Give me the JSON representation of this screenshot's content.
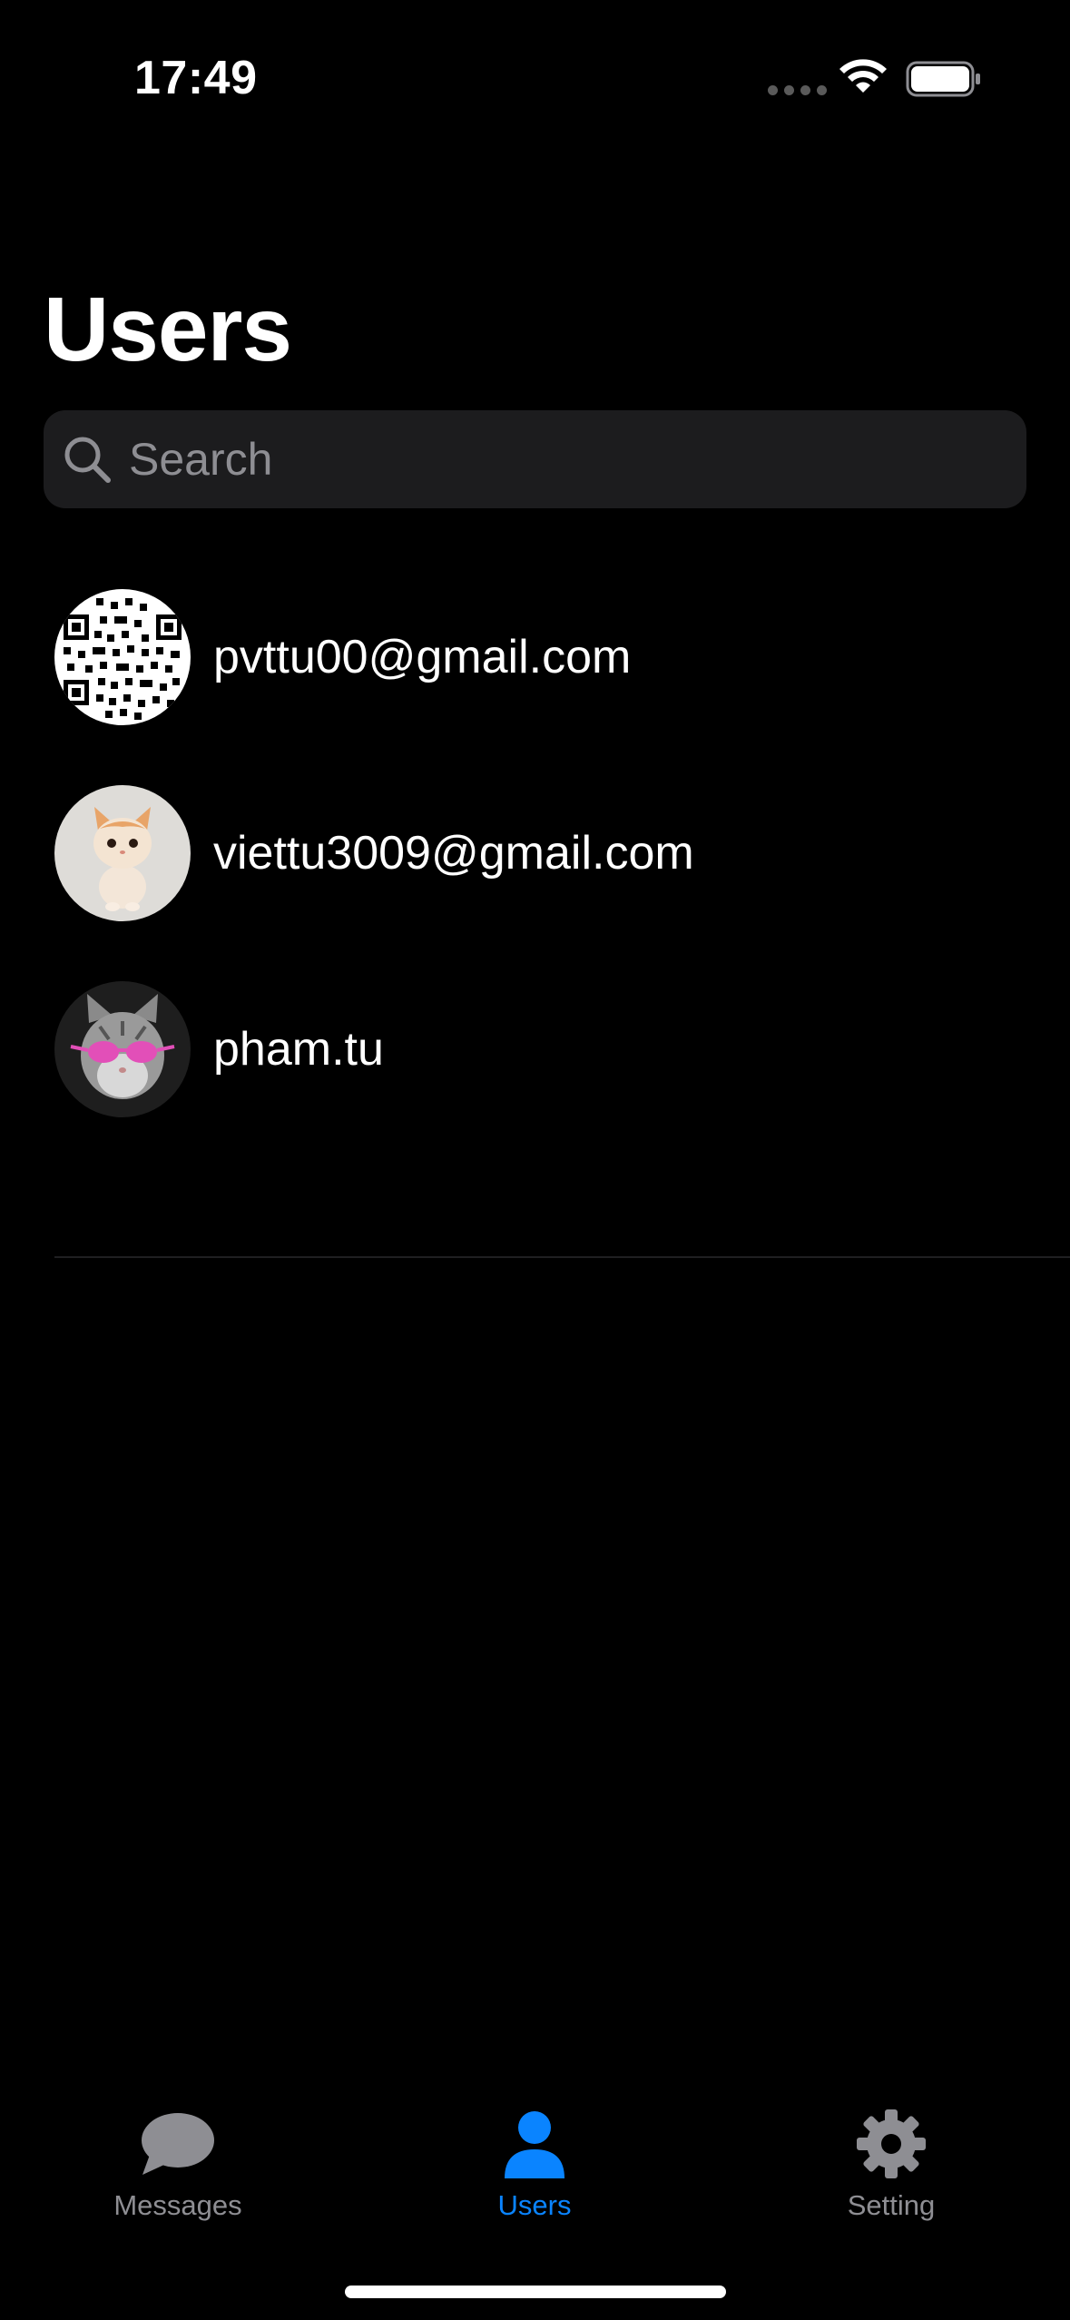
{
  "status_bar": {
    "time": "17:49"
  },
  "header": {
    "title": "Users"
  },
  "search": {
    "placeholder": "Search",
    "value": ""
  },
  "users": [
    {
      "name": "pvttu00@gmail.com",
      "avatar": "qr-code-avatar"
    },
    {
      "name": "viettu3009@gmail.com",
      "avatar": "kitten-avatar"
    },
    {
      "name": "pham.tu",
      "avatar": "cat-with-pink-sunglasses-avatar"
    }
  ],
  "tab_bar": {
    "tabs": [
      {
        "label": "Messages",
        "icon": "chat-bubble-icon",
        "active": false
      },
      {
        "label": "Users",
        "icon": "person-icon",
        "active": true
      },
      {
        "label": "Setting",
        "icon": "gear-icon",
        "active": false
      }
    ]
  },
  "colors": {
    "background": "#000000",
    "search_field": "#1c1c1e",
    "accent": "#0a84ff",
    "inactive_tab": "#8e8e93"
  }
}
